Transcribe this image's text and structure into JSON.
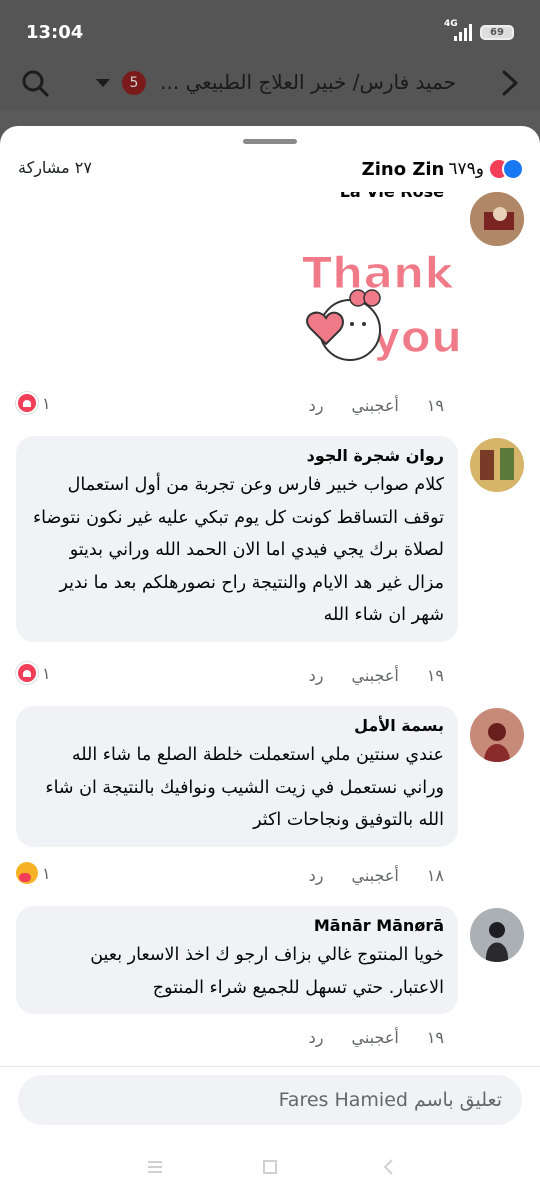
{
  "status": {
    "time": "13:04",
    "network": "4G",
    "battery": "69"
  },
  "header": {
    "title": "حميد فارس/ خبير العلاج الطبيعي ...",
    "badge": "5"
  },
  "sheet": {
    "reactors_name": "Zino Zin",
    "reactors_count": "و٦٧٩",
    "shares": "٢٧ مشاركة"
  },
  "comments": [
    {
      "author": "La Vie Rose",
      "sticker": {
        "line1": "Thank",
        "line2": "you"
      },
      "time": "١٩",
      "like": "أعجبني",
      "reply": "رد",
      "reactions": "١"
    },
    {
      "author": "روان شجرة الجود",
      "text": "كلام صواب خبير فارس وعن تجربة من أول استعمال توقف التساقط كونت كل يوم تبكي عليه غير نكون نتوضاء لصلاة برك يجي فيدي اما الان الحمد الله وراني بديتو مزال غير هد الايام والنتيجة راح نصورهلكم بعد ما ندير شهر ان شاء الله",
      "time": "١٩",
      "like": "أعجبني",
      "reply": "رد",
      "reactions": "١"
    },
    {
      "author": "بسمة الأمل",
      "text": "عندي سنتين ملي استعملت خلطة الصلع ما شاء الله وراني نستعمل في زيت الشيب ونوافيك بالنتيجة ان شاء الله بالتوفيق ونجاحات اكثر",
      "time": "١٨",
      "like": "أعجبني",
      "reply": "رد",
      "reactions": "١"
    },
    {
      "author": "Mānār Mānørā",
      "text": "خويا المنتوج غالي بزاف ارجو ك اخذ الاسعار بعين الاعتبار.  حتي تسهل للجميع  شراء  المنتوج",
      "time": "١٩",
      "like": "أعجبني",
      "reply": "رد"
    }
  ],
  "composer": {
    "placeholder": "تعليق باسم Fares Hamied"
  },
  "colors": {
    "accent": "#1877f2",
    "love": "#f33e58",
    "bubble": "#f0f2f5"
  },
  "icons": [
    "search-icon",
    "back-arrow-icon",
    "dropdown-caret-icon",
    "like-reaction-icon",
    "love-reaction-icon",
    "care-reaction-icon",
    "menu-nav-icon",
    "home-nav-icon",
    "back-nav-icon"
  ]
}
